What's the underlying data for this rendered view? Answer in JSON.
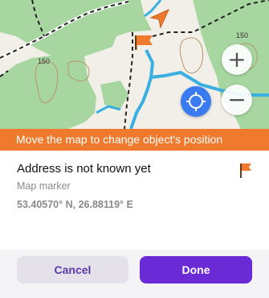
{
  "map": {
    "contour_labels": [
      "150",
      "150"
    ],
    "zoom_in_icon": "plus-icon",
    "zoom_out_icon": "minus-icon",
    "my_location_icon": "crosshair-icon",
    "position_marker_icon": "flag-icon",
    "direction_icon": "navigation-arrow-icon",
    "colors": {
      "forest": "#a7d6a0",
      "water": "#3ab0e0",
      "accent": "#ef7a2d"
    }
  },
  "banner": {
    "text": "Move the map to change object's position"
  },
  "details": {
    "title": "Address is not known yet",
    "subtitle": "Map marker",
    "coordinates": "53.40570° N, 26.88119° E"
  },
  "actions": {
    "cancel_label": "Cancel",
    "done_label": "Done"
  }
}
